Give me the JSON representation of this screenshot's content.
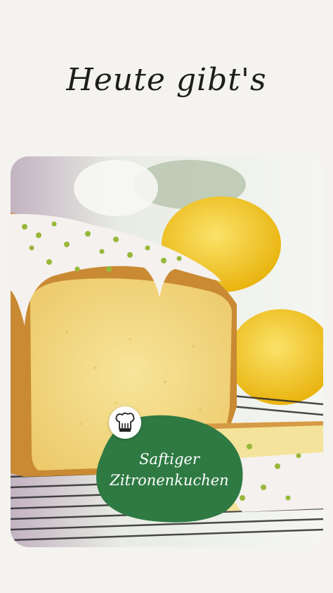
{
  "headline": "Heute gibt's",
  "badge": {
    "line1": "Saftiger",
    "line2": "Zitronenkuchen"
  },
  "colors": {
    "background": "#f4f3ef",
    "badge_green": "#2f7a43",
    "lemon": "#f4c51c",
    "cake_crumb": "#f1d782",
    "cake_crust": "#c98a33",
    "icing": "#f5f1ee"
  },
  "icons": {
    "chef_hat": "chef-hat-icon"
  }
}
